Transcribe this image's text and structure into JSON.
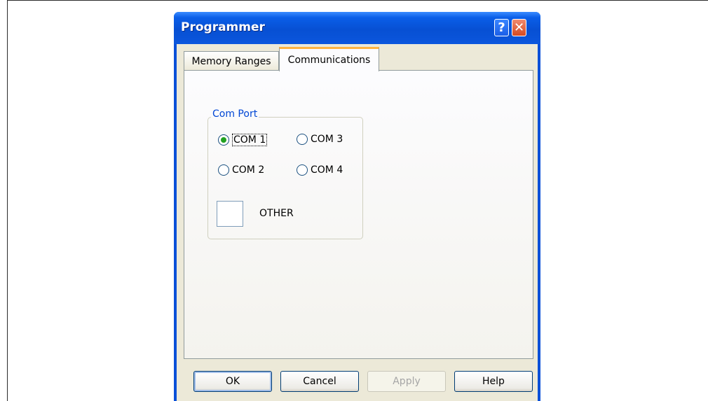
{
  "window": {
    "title": "Programmer",
    "help_label": "?",
    "close_label": "✕"
  },
  "tabs": [
    {
      "label": "Memory Ranges"
    },
    {
      "label": "Communications",
      "active": true
    }
  ],
  "com_port": {
    "label": "Com Port",
    "options": [
      {
        "label": "COM 1",
        "selected": true
      },
      {
        "label": "COM 3",
        "selected": false
      },
      {
        "label": "COM 2",
        "selected": false
      },
      {
        "label": "COM 4",
        "selected": false
      }
    ],
    "other_label": "OTHER",
    "other_value": ""
  },
  "buttons": {
    "ok": "OK",
    "cancel": "Cancel",
    "apply": "Apply",
    "help": "Help"
  },
  "colors": {
    "title_bar": "#0a50d8",
    "group_label": "#0046d5",
    "radio_selected": "#21a121",
    "active_tab_accent": "#ffb340"
  }
}
